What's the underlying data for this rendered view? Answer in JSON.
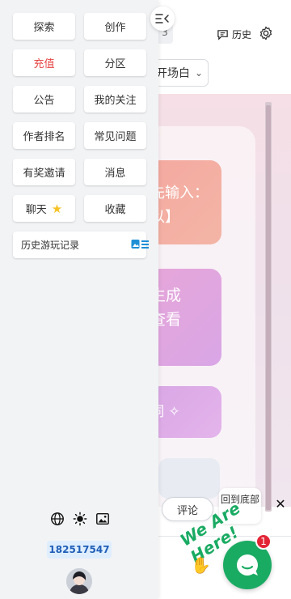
{
  "under": {
    "top_badge": "3",
    "history_label": "历史",
    "select_value": "开场白",
    "card1_lines": [
      "先输入：",
      "以】"
    ],
    "card2_lines": [
      "生成",
      "查看"
    ],
    "card3_text": "词 ✧",
    "comment_label": "评论",
    "back_to_bottom": "回到底部",
    "close_symbol": "✕",
    "chat_slogan": "We Are Here!",
    "chat_badge_count": "1"
  },
  "drawer": {
    "tiles": [
      {
        "label": "探索"
      },
      {
        "label": "创作"
      },
      {
        "label": "充值"
      },
      {
        "label": "分区"
      },
      {
        "label": "公告"
      },
      {
        "label": "我的关注"
      },
      {
        "label": "作者排名"
      },
      {
        "label": "常见问题"
      },
      {
        "label": "有奖邀请"
      },
      {
        "label": "消息"
      },
      {
        "label": "聊天"
      },
      {
        "label": "收藏"
      }
    ],
    "history_record": "历史游玩记录",
    "uid": "182517547"
  },
  "colors": {
    "accent_red": "#e64545",
    "uid_bg": "#dfeefe",
    "chat_green": "#1aab63"
  }
}
